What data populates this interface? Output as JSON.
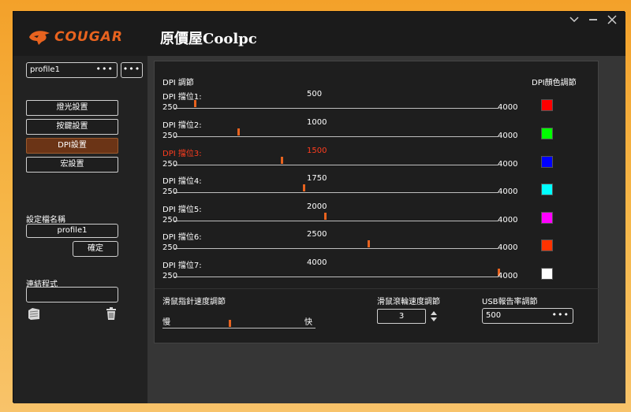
{
  "app": {
    "logo_text": "COUGAR",
    "brand_text": "原價屋Coolpc",
    "window_controls": [
      "chevron-down-icon",
      "minimize-icon",
      "close-icon"
    ]
  },
  "sidebar": {
    "profile_value": "profile1",
    "dots": "•••",
    "menu": [
      {
        "label": "燈光設置",
        "active": false
      },
      {
        "label": "按鍵設置",
        "active": false
      },
      {
        "label": "DPI設置",
        "active": true
      },
      {
        "label": "宏設置",
        "active": false
      }
    ],
    "profile_name_label": "設定檔名稱",
    "profile_name_value": "profile1",
    "confirm_label": "確定",
    "link_program_label": "連結程式",
    "link_program_value": ""
  },
  "dpi": {
    "title": "DPI 調節",
    "color_title": "DPI顏色調節",
    "min_label": "250",
    "max_label": "4000",
    "range": [
      250,
      4000
    ],
    "rows": [
      {
        "label": "DPI 擋位1:",
        "value": "500",
        "value_num": 500,
        "color": "#ff0000",
        "active": false
      },
      {
        "label": "DPI 擋位2:",
        "value": "1000",
        "value_num": 1000,
        "color": "#00ff00",
        "active": false
      },
      {
        "label": "DPI 擋位3:",
        "value": "1500",
        "value_num": 1500,
        "color": "#0000ff",
        "active": true
      },
      {
        "label": "DPI 擋位4:",
        "value": "1750",
        "value_num": 1750,
        "color": "#00ffff",
        "active": false
      },
      {
        "label": "DPI 擋位5:",
        "value": "2000",
        "value_num": 2000,
        "color": "#ff00ff",
        "active": false
      },
      {
        "label": "DPI 擋位6:",
        "value": "2500",
        "value_num": 2500,
        "color": "#ff3300",
        "active": false
      },
      {
        "label": "DPI 擋位7:",
        "value": "4000",
        "value_num": 4000,
        "color": "#ffffff",
        "active": false
      }
    ]
  },
  "pointer": {
    "title": "滑鼠指針速度調節",
    "slow_label": "慢",
    "fast_label": "快",
    "level": 0.44
  },
  "scroll": {
    "title": "滑鼠滾輪速度調節",
    "value": "3"
  },
  "usb": {
    "title": "USB報告率調節",
    "value": "500",
    "dots": "•••"
  },
  "colors": {
    "accent": "#e8631f",
    "active_text": "#ff3d1f"
  }
}
